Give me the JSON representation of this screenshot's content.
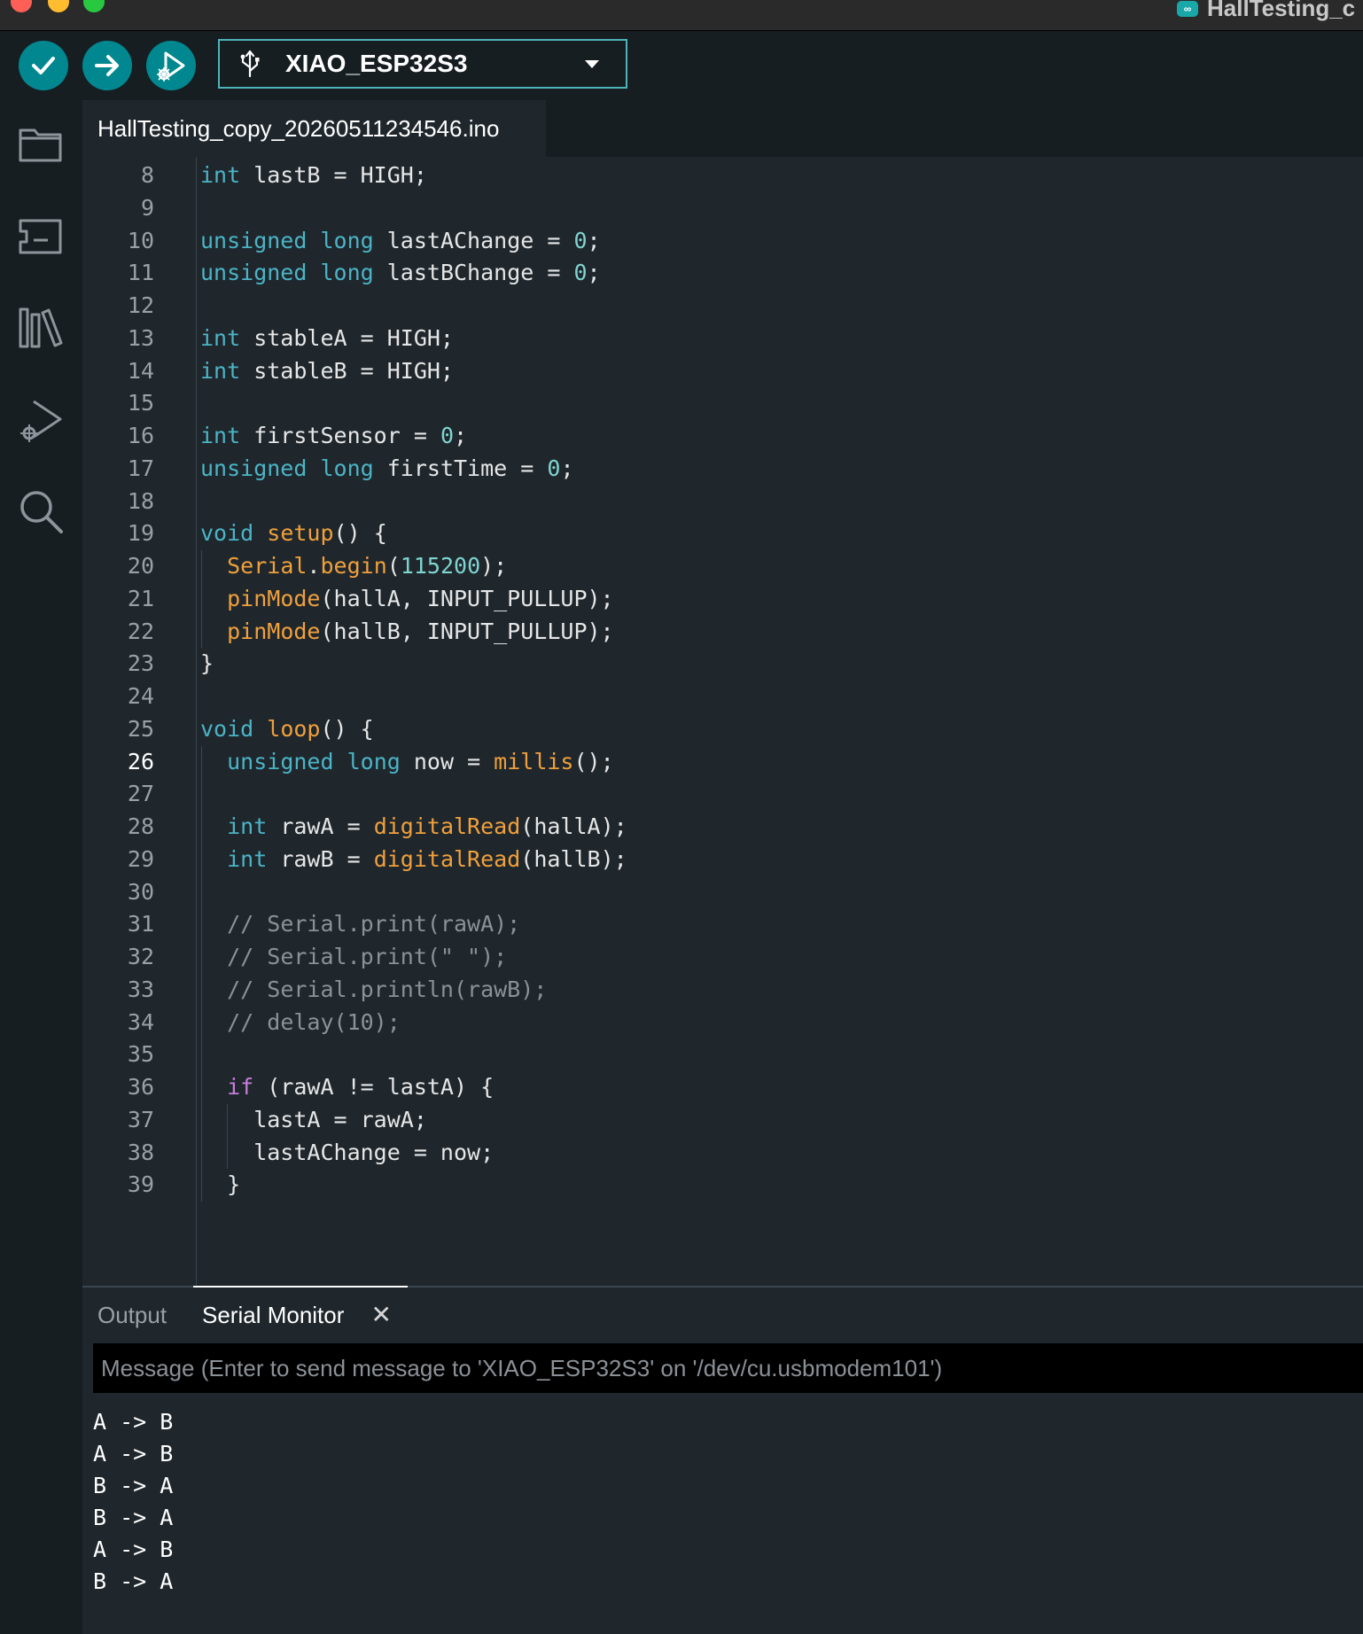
{
  "window": {
    "title": "HallTesting_c",
    "app_icon_glyph": "∞"
  },
  "toolbar": {
    "verify_icon": "check-icon",
    "upload_icon": "arrow-right-icon",
    "debug_icon": "debug-icon",
    "board_name": "XIAO_ESP32S3",
    "board_icon": "usb-icon",
    "accent_color": "#00878f"
  },
  "sidebar": {
    "items": [
      "sketchbook-icon",
      "boards-manager-icon",
      "library-manager-icon",
      "debug-icon",
      "search-icon"
    ]
  },
  "editor": {
    "file_tab": "HallTesting_copy_20260511234546.ino",
    "active_line": 26,
    "lines": [
      {
        "n": "8",
        "code": "int lastB = HIGH;"
      },
      {
        "n": "9",
        "code": ""
      },
      {
        "n": "10",
        "code": "unsigned long lastAChange = 0;"
      },
      {
        "n": "11",
        "code": "unsigned long lastBChange = 0;"
      },
      {
        "n": "12",
        "code": ""
      },
      {
        "n": "13",
        "code": "int stableA = HIGH;"
      },
      {
        "n": "14",
        "code": "int stableB = HIGH;"
      },
      {
        "n": "15",
        "code": ""
      },
      {
        "n": "16",
        "code": "int firstSensor = 0;"
      },
      {
        "n": "17",
        "code": "unsigned long firstTime = 0;"
      },
      {
        "n": "18",
        "code": ""
      },
      {
        "n": "19",
        "code": "void setup() {"
      },
      {
        "n": "20",
        "code": "  Serial.begin(115200);"
      },
      {
        "n": "21",
        "code": "  pinMode(hallA, INPUT_PULLUP);"
      },
      {
        "n": "22",
        "code": "  pinMode(hallB, INPUT_PULLUP);"
      },
      {
        "n": "23",
        "code": "}"
      },
      {
        "n": "24",
        "code": ""
      },
      {
        "n": "25",
        "code": "void loop() {"
      },
      {
        "n": "26",
        "code": "  unsigned long now = millis();"
      },
      {
        "n": "27",
        "code": ""
      },
      {
        "n": "28",
        "code": "  int rawA = digitalRead(hallA);"
      },
      {
        "n": "29",
        "code": "  int rawB = digitalRead(hallB);"
      },
      {
        "n": "30",
        "code": ""
      },
      {
        "n": "31",
        "code": "  // Serial.print(rawA);"
      },
      {
        "n": "32",
        "code": "  // Serial.print(\" \");"
      },
      {
        "n": "33",
        "code": "  // Serial.println(rawB);"
      },
      {
        "n": "34",
        "code": "  // delay(10);"
      },
      {
        "n": "35",
        "code": ""
      },
      {
        "n": "36",
        "code": "  if (rawA != lastA) {"
      },
      {
        "n": "37",
        "code": "    lastA = rawA;"
      },
      {
        "n": "38",
        "code": "    lastAChange = now;"
      },
      {
        "n": "39",
        "code": "  }"
      }
    ]
  },
  "panel": {
    "tabs": [
      "Output",
      "Serial Monitor"
    ],
    "active_tab": "Serial Monitor",
    "close_glyph": "✕",
    "message_placeholder": "Message (Enter to send message to 'XIAO_ESP32S3' on '/dev/cu.usbmodem101')",
    "output_lines": [
      "A -> B",
      "A -> B",
      "B -> A",
      "B -> A",
      "A -> B",
      "B -> A"
    ]
  }
}
